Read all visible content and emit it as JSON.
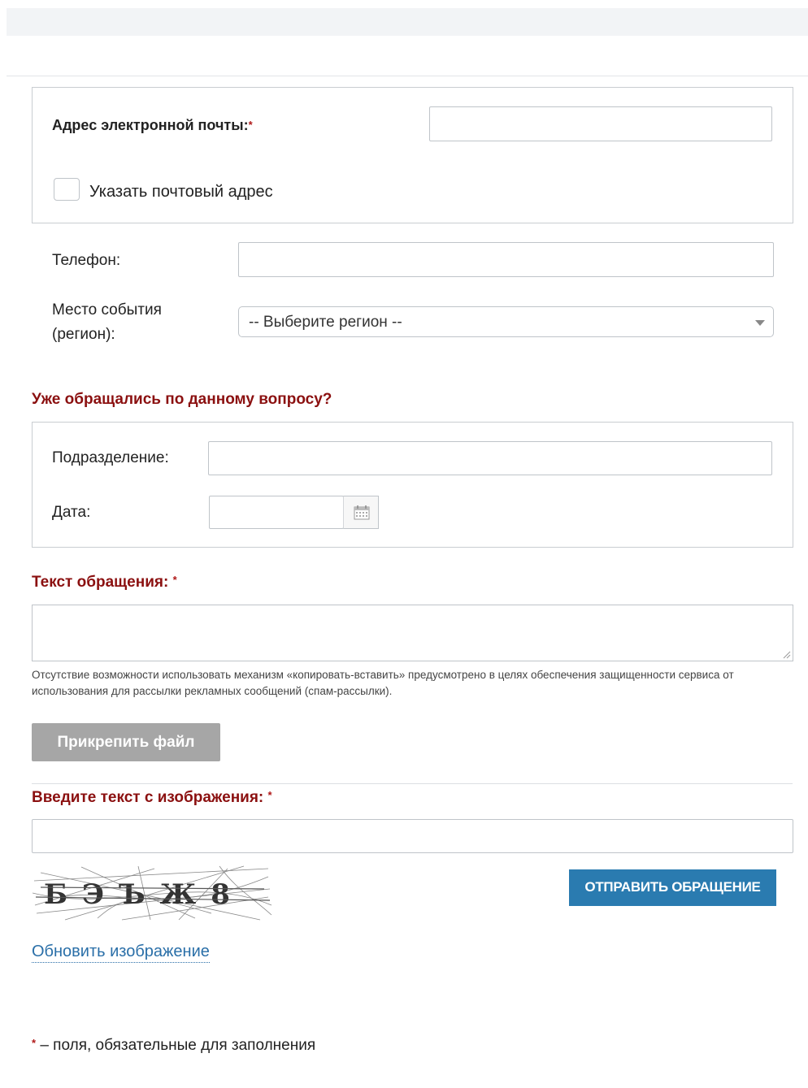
{
  "form": {
    "email": {
      "label": "Адрес электронной почты:",
      "required_mark": "*",
      "value": ""
    },
    "postal_address_checkbox": {
      "label": "Указать почтовый адрес",
      "checked": false
    },
    "phone": {
      "label": "Телефон:",
      "value": ""
    },
    "region": {
      "label_line1": "Место события",
      "label_line2": "(регион):",
      "selected": "-- Выберите регион --"
    },
    "previous_request": {
      "title": "Уже обращались по данному вопросу?",
      "department_label": "Подразделение:",
      "department_value": "",
      "date_label": "Дата:",
      "date_value": ""
    },
    "message": {
      "title": "Текст обращения:",
      "required_mark": "*",
      "value": "",
      "note": "Отсутствие возможности использовать механизм «копировать-вставить» предусмотрено в целях обеспечения защищенности сервиса от использования для рассылки рекламных сообщений (спам-рассылки)."
    },
    "attach_button": "Прикрепить файл",
    "captcha": {
      "title": "Введите текст с изображения:",
      "required_mark": "*",
      "value": "",
      "image_text": "БЭЪЖ8",
      "refresh_link": "Обновить изображение"
    },
    "submit_button": "ОТПРАВИТЬ ОБРАЩЕНИЕ",
    "footnote_mark": "*",
    "footnote_text": " – поля, обязательные для заполнения"
  },
  "colors": {
    "section_title": "#8b1010",
    "required": "#b01818",
    "submit_bg": "#2a7bb0",
    "attach_bg": "#a6a6a6",
    "link": "#2a6fa8"
  }
}
